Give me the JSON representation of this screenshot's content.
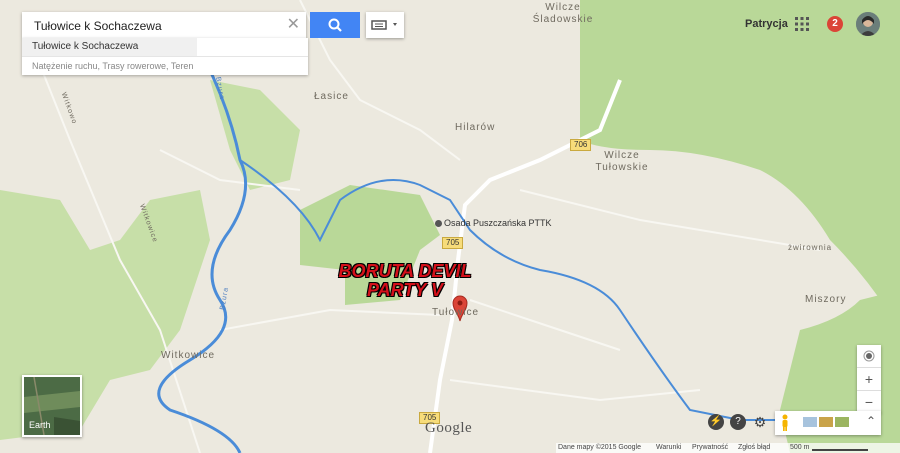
{
  "search": {
    "value": "Tułowice k Sochaczewa",
    "suggestion": "Tułowice k Sochaczewa",
    "layers_hint": "Natężenie ruchu, Trasy rowerowe, Teren"
  },
  "user": {
    "name": "Patrycja",
    "notifications": "2"
  },
  "map": {
    "places": {
      "wilcze_sladowskie": "Wilcze\nŚladowskie",
      "lasice": "Łasice",
      "hilarow": "Hilarów",
      "wilcze_tulowskie": "Wilcze\nTułowskie",
      "zwirownia": "żwirownia",
      "miszory": "Miszory",
      "tulowice": "Tułowice",
      "witkowice": "Witkowice",
      "witkowice_road": "Witkowice",
      "bzura_1": "Bzura",
      "bzura_2": "Bzura",
      "witkowo": "Witkowo"
    },
    "poi": "Osada Puszczańska PTTK",
    "roads": {
      "r706": "706",
      "r705a": "705",
      "r705b": "705"
    },
    "event_title": "BORUTA DEVIL\nPARTY V"
  },
  "controls": {
    "earth_label": "Earth",
    "zoom_in": "+",
    "zoom_out": "−",
    "expand": "⌃"
  },
  "footer": {
    "copyright": "Dane mapy ©2015 Google",
    "terms": "Warunki",
    "privacy": "Prywatność",
    "report": "Zgłoś błąd",
    "scale": "500 m"
  },
  "logo": "Google",
  "colors": {
    "search_button": "#4285f4",
    "badge": "#db4437",
    "pin": "#db4437",
    "forest": "#b9d898",
    "river": "#4a8cd8",
    "road": "#ffffff"
  }
}
